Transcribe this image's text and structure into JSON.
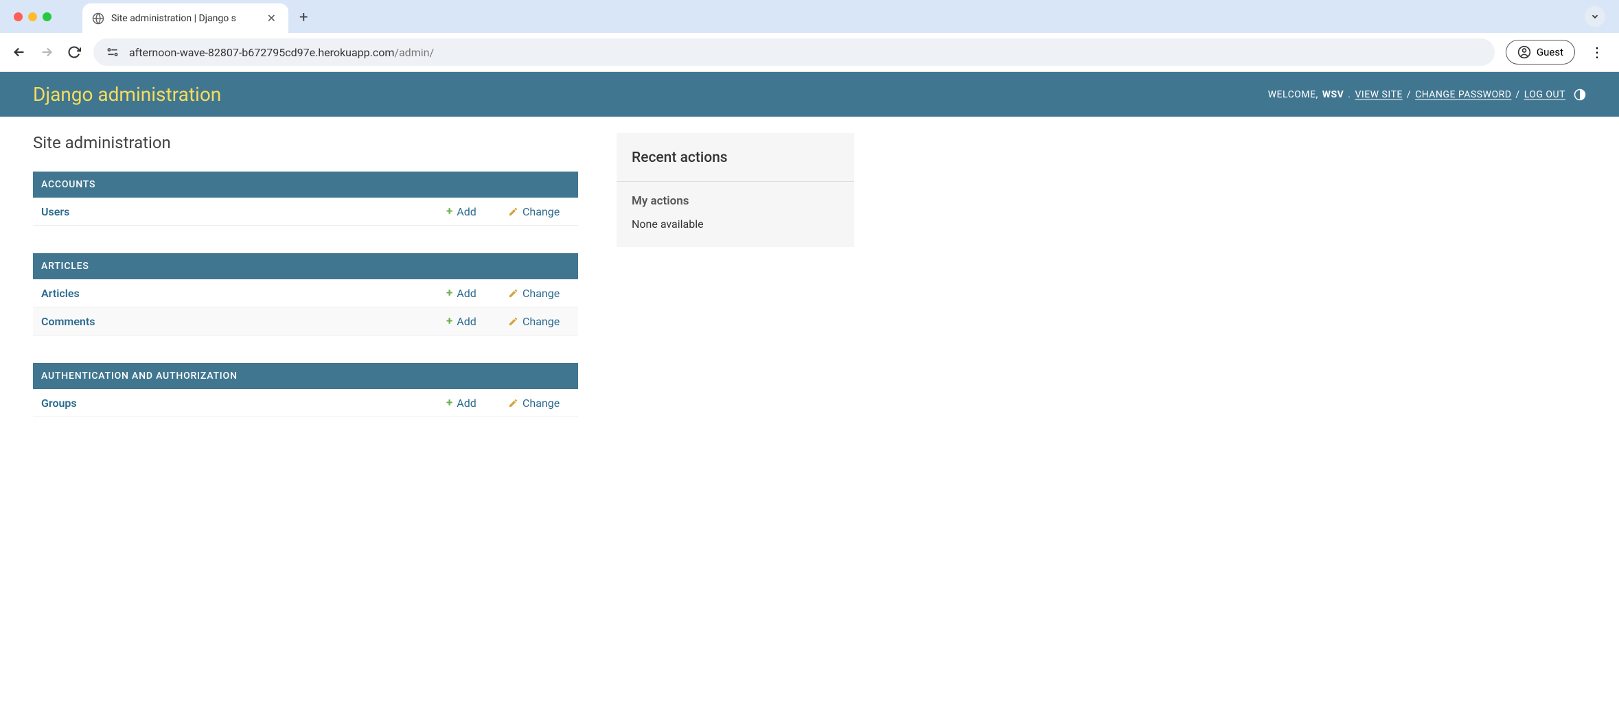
{
  "browser": {
    "tab_title": "Site administration | Django s",
    "url_host": "afternoon-wave-82807-b672795cd97e.herokuapp.com",
    "url_path": "/admin/",
    "guest_label": "Guest"
  },
  "header": {
    "brand": "Django administration",
    "welcome": "WELCOME,",
    "username": "WSV",
    "view_site": "VIEW SITE",
    "change_password": "CHANGE PASSWORD",
    "logout": "LOG OUT"
  },
  "page": {
    "title": "Site administration"
  },
  "modules": [
    {
      "name": "ACCOUNTS",
      "models": [
        {
          "name": "Users",
          "add": "Add",
          "change": "Change"
        }
      ]
    },
    {
      "name": "ARTICLES",
      "models": [
        {
          "name": "Articles",
          "add": "Add",
          "change": "Change"
        },
        {
          "name": "Comments",
          "add": "Add",
          "change": "Change"
        }
      ]
    },
    {
      "name": "AUTHENTICATION AND AUTHORIZATION",
      "models": [
        {
          "name": "Groups",
          "add": "Add",
          "change": "Change"
        }
      ]
    }
  ],
  "sidebar": {
    "recent_actions": "Recent actions",
    "my_actions": "My actions",
    "none_available": "None available"
  }
}
